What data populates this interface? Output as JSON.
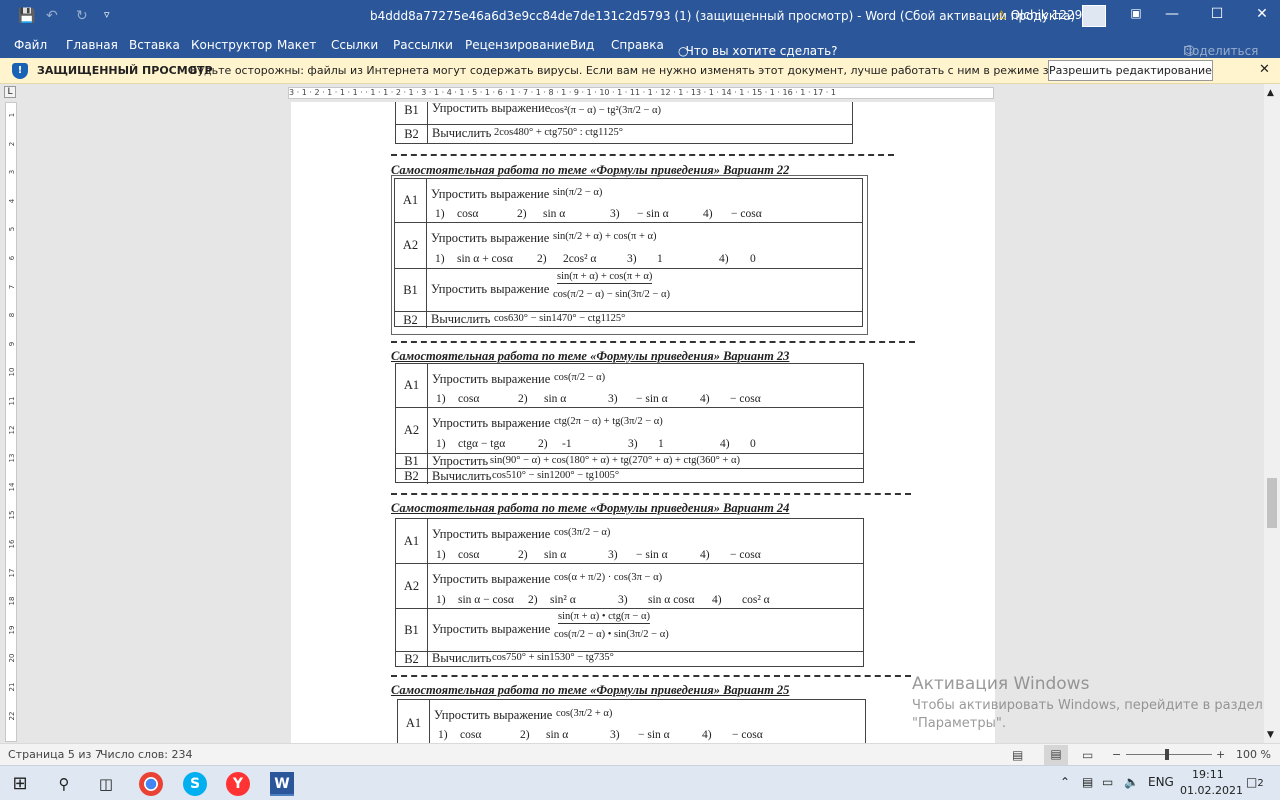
{
  "title_bar": {
    "save_icon": "save-icon",
    "undo_icon": "undo-icon",
    "redo_icon": "redo-icon",
    "customize_icon": "customize-icon",
    "doc_title": "b4ddd8a77275e46a6d3e9cc84de7de131c2d5793 (1) (защищенный просмотр)  -  Word (Сбой активации продукта)",
    "user_name": "Olchik 1229",
    "warning_icon": "warning-icon",
    "ribbon_display_icon": "ribbon-display-icon",
    "minimize_icon": "minimize-icon",
    "maximize_icon": "maximize-icon",
    "close_icon": "close-icon"
  },
  "menu": {
    "items": [
      "Файл",
      "Главная",
      "Вставка",
      "Конструктор",
      "Макет",
      "Ссылки",
      "Рассылки",
      "Рецензирование",
      "Вид",
      "Справка"
    ],
    "tell_me": "Что вы хотите сделать?",
    "share": "Поделиться"
  },
  "protected_view": {
    "title": "ЗАЩИЩЕННЫЙ ПРОСМОТР",
    "message": "Будьте осторожны: файлы из Интернета могут содержать вирусы. Если вам не нужно изменять этот документ, лучше работать с ним в режиме защищенного просмотра.",
    "enable_button": "Разрешить редактирование",
    "close_icon": "close-icon"
  },
  "ruler": {
    "tab_selector": "L",
    "h_marks": "3 · 1 · 2 · 1 · 1 · 1 ·   · 1 · 1 · 2 · 1 · 3 · 1 · 4 · 1 · 5 · 1 · 6 · 1 · 7 · 1 · 8 · 1 · 9 · 1 · 10 · 1 · 11 · 1 · 12 · 1 · 13 · 1 · 14 · 1 · 15 · 1 · 16 · 1 · 17 · 1",
    "v_marks": [
      "1",
      "2",
      "3",
      "4",
      "5",
      "6",
      "7",
      "8",
      "9",
      "10",
      "11",
      "12",
      "13",
      "14",
      "15",
      "16",
      "17",
      "18",
      "19",
      "20",
      "21",
      "22"
    ]
  },
  "document": {
    "top_table": {
      "rows": [
        {
          "code": "B1",
          "text": "Упростить выражение",
          "expr": "cos²(π − α) − tg²(3π/2 − α)"
        },
        {
          "code": "B2",
          "text": "Вычислить",
          "expr": "2cos480° + ctg750° : ctg1125°"
        }
      ]
    },
    "variants": [
      {
        "heading": "Самостоятельная работа по теме «Формулы приведения»  Вариант 22",
        "rows": [
          {
            "code": "A1",
            "text": "Упростить выражение",
            "expr": "sin(π/2 − α)",
            "answers": [
              "1)",
              "cosα",
              "2)",
              "sin α",
              "3)",
              "− sin α",
              "4)",
              "− cosα"
            ]
          },
          {
            "code": "A2",
            "text": "Упростить выражение",
            "expr": "sin(π/2 + α) + cos(π + α)",
            "answers": [
              "1)",
              "sin α + cosα",
              "2)",
              "2cos² α",
              "3)",
              "1",
              "4)",
              "0"
            ]
          },
          {
            "code": "B1",
            "text": "Упростить выражение",
            "expr": "sin(π + α) + cos(π + α)",
            "expr2": "cos(π/2 − α) − sin(3π/2 − α)"
          },
          {
            "code": "B2",
            "text": "Вычислить",
            "expr": "cos630° − sin1470° − ctg1125°"
          }
        ]
      },
      {
        "heading": "Самостоятельная работа по теме «Формулы приведения»  Вариант 23",
        "rows": [
          {
            "code": "A1",
            "text": "Упростить выражение",
            "expr": "cos(π/2 − α)",
            "answers": [
              "1)",
              "cosα",
              "2)",
              "sin α",
              "3)",
              "− sin α",
              "4)",
              "− cosα"
            ]
          },
          {
            "code": "A2",
            "text": "Упростить выражение",
            "expr": "ctg(2π − α) + tg(3π/2 − α)",
            "answers": [
              "1)",
              "ctgα − tgα",
              "2)",
              "-1",
              "3)",
              "1",
              "4)",
              "0"
            ]
          },
          {
            "code": "B1",
            "text": "Упростить",
            "expr": "sin(90° − α) + cos(180° + α) + tg(270° + α) + ctg(360° + α)"
          },
          {
            "code": "B2",
            "text": "Вычислить",
            "expr": "cos510° − sin1200° − tg1005°"
          }
        ]
      },
      {
        "heading": "Самостоятельная работа по теме «Формулы приведения»  Вариант 24",
        "rows": [
          {
            "code": "A1",
            "text": "Упростить выражение",
            "expr": "cos(3π/2 − α)",
            "answers": [
              "1)",
              "cosα",
              "2)",
              "sin α",
              "3)",
              "− sin α",
              "4)",
              "− cosα"
            ]
          },
          {
            "code": "A2",
            "text": "Упростить выражение",
            "expr": "cos(α + π/2) · cos(3π − α)",
            "answers": [
              "1)",
              "sin α − cosα",
              "2)",
              "sin² α",
              "3)",
              "sin α cosα",
              "4)",
              "cos² α"
            ]
          },
          {
            "code": "B1",
            "text": "Упростить выражение",
            "expr": "sin(π + α) • ctg(π − α)",
            "expr2": "cos(π/2 − α) • sin(3π/2 − α)"
          },
          {
            "code": "B2",
            "text": "Вычислить",
            "expr": "cos750° + sin1530° − tg735°"
          }
        ]
      },
      {
        "heading": "Самостоятельная работа по теме «Формулы приведения»  Вариант 25",
        "rows": [
          {
            "code": "A1",
            "text": "Упростить выражение",
            "expr": "cos(3π/2 + α)",
            "answers": [
              "1)",
              "cosα",
              "2)",
              "sin α",
              "3)",
              "− sin α",
              "4)",
              "− cosα"
            ]
          }
        ]
      }
    ]
  },
  "status_bar": {
    "page": "Страница 5 из 7",
    "words": "Число слов: 234",
    "read_mode_icon": "read-mode-icon",
    "print_layout_icon": "print-layout-icon",
    "web_layout_icon": "web-layout-icon",
    "zoom_out": "−",
    "zoom_in": "+",
    "zoom": "100 %",
    "zoom_level": 1.0
  },
  "watermark": {
    "line1": "Активация Windows",
    "line2": "Чтобы активировать Windows, перейдите в раздел",
    "line3": "\"Параметры\"."
  },
  "taskbar": {
    "apps": [
      "start-icon",
      "search-icon",
      "task-view-icon",
      "chrome-icon",
      "skype-icon",
      "yandex-icon",
      "word-icon"
    ],
    "lang": "ENG",
    "time": "19:11",
    "date": "01.02.2021",
    "notifications": "2"
  }
}
